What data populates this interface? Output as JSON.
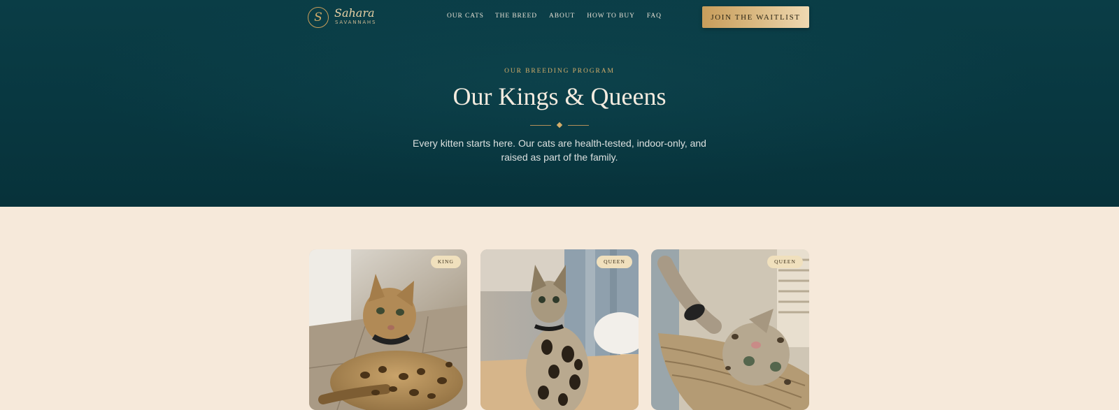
{
  "brand": {
    "name": "Sahara",
    "sub": "SAVANNAHS",
    "mark": "S"
  },
  "nav": {
    "items": [
      "OUR CATS",
      "THE BREED",
      "ABOUT",
      "HOW TO BUY",
      "FAQ"
    ],
    "cta": "JOIN THE WAITLIST"
  },
  "hero": {
    "eyebrow": "OUR BREEDING PROGRAM",
    "title": "Our Kings & Queens",
    "subtitle": "Every kitten starts here. Our cats are health-tested, indoor-only, and raised as part of the family."
  },
  "cards": [
    {
      "badge": "KING"
    },
    {
      "badge": "QUEEN"
    },
    {
      "badge": "QUEEN"
    }
  ],
  "colors": {
    "hero_bg": "#0a3d46",
    "accent_gold": "#d4ad6a",
    "page_bg": "#f6e9da"
  }
}
